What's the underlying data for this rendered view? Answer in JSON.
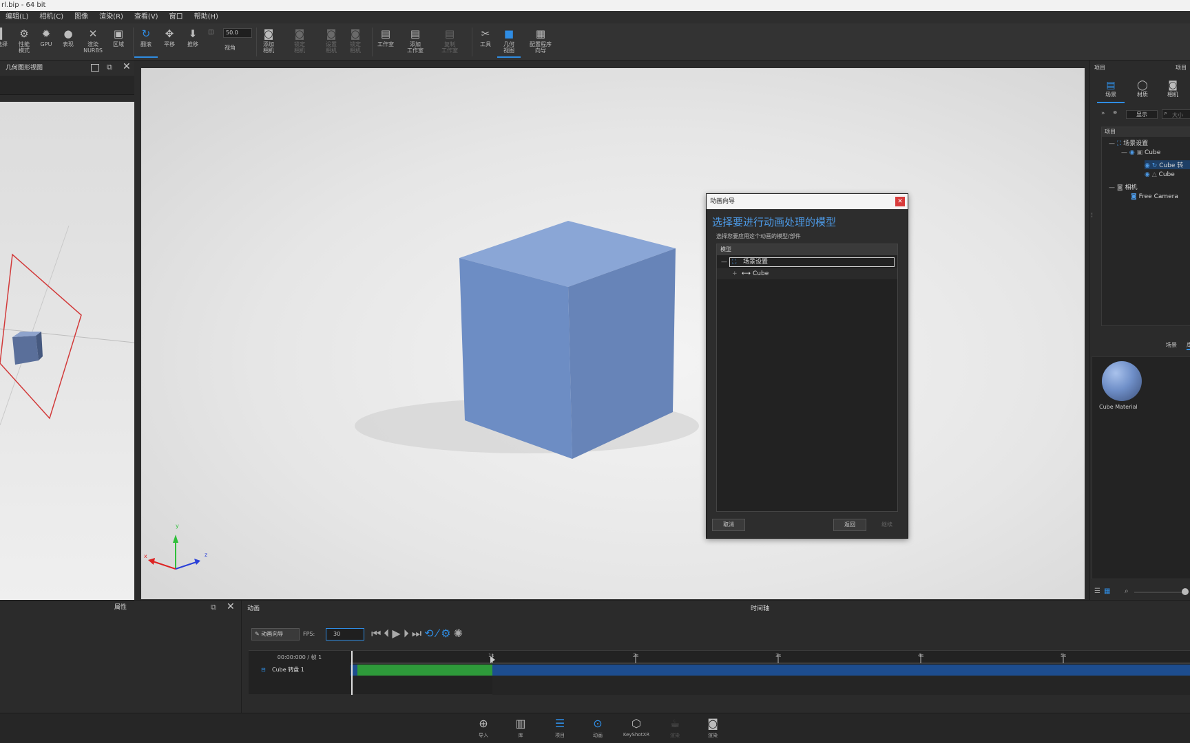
{
  "window": {
    "title": "rl.bip - 64 bit"
  },
  "menu": [
    "编辑(L)",
    "相机(C)",
    "图像",
    "渲染(R)",
    "查看(V)",
    "窗口",
    "帮助(H)"
  ],
  "toolbar": {
    "items": [
      {
        "label": "选择",
        "icon": "cursor-icon"
      },
      {
        "label": "性能\n模式",
        "icon": "gauge-icon"
      },
      {
        "label": "GPU",
        "icon": "gpu-icon"
      },
      {
        "label": "表现",
        "icon": "sphere-icon"
      },
      {
        "label": "渲染\nNURBS",
        "icon": "nurbs-icon"
      },
      {
        "label": "区域",
        "icon": "region-icon"
      },
      {
        "label": "翻滚",
        "icon": "rotate-icon"
      },
      {
        "label": "平移",
        "icon": "pan-icon"
      },
      {
        "label": "推移",
        "icon": "dolly-icon"
      },
      {
        "label": "视角",
        "icon": "fov-icon"
      },
      {
        "label": "添加\n相机",
        "icon": "add-camera-icon"
      },
      {
        "label": "锁定\n相机",
        "icon": "lock-camera-icon"
      },
      {
        "label": "设置\n相机",
        "icon": "set-camera-icon"
      },
      {
        "label": "锁定\n相机",
        "icon": "camera2-icon"
      },
      {
        "label": "工作室",
        "icon": "studio-icon"
      },
      {
        "label": "添加\n工作室",
        "icon": "add-studio-icon"
      },
      {
        "label": "复制\n工作室",
        "icon": "copy-studio-icon"
      },
      {
        "label": "工具",
        "icon": "tools-icon"
      },
      {
        "label": "几何\n视图",
        "icon": "geometry-view-icon"
      },
      {
        "label": "配置程序\n向导",
        "icon": "configurator-icon"
      }
    ],
    "fov_value": "50.0"
  },
  "left_panel": {
    "title": "几何图形视图"
  },
  "dialog": {
    "title": "动画向导",
    "heading": "选择要进行动画处理的模型",
    "subtitle": "选择您要应用这个动画的模型/部件",
    "tree_header": "模型",
    "tree": [
      {
        "label": "场景设置",
        "selected": true
      },
      {
        "label": "Cube",
        "selected": false
      }
    ],
    "cancel": "取消",
    "back": "返回",
    "next": "继续"
  },
  "right_panel": {
    "title": "项目",
    "tabs": [
      "场景",
      "材质",
      "相机"
    ],
    "display_btn": "显示",
    "search_placeholder": "大小",
    "tree_header": "项目",
    "tree": [
      {
        "label": "场景设置",
        "indent": 0
      },
      {
        "label": "Cube",
        "indent": 1
      },
      {
        "label": "Cube 转",
        "indent": 2
      },
      {
        "label": "Cube",
        "indent": 2
      },
      {
        "label": "相机",
        "indent": 0
      },
      {
        "label": "Free Camera",
        "indent": 1
      }
    ],
    "mat_tabs": [
      "场景",
      "库"
    ],
    "material": "Cube Material"
  },
  "bottom": {
    "attributes_title": "属性",
    "animation_title": "动画",
    "timeline_title": "时间轴",
    "wizard_btn": "动画向导",
    "fps_label": "FPS:",
    "fps_value": "30",
    "time_readout": "00:00:000 / 帧 1",
    "track_name": "Cube 转盘 1",
    "ticks": [
      "1s",
      "2s",
      "3s",
      "4s",
      "5s"
    ]
  },
  "dock": [
    {
      "label": "导入",
      "icon": "import-icon"
    },
    {
      "label": "库",
      "icon": "library-icon"
    },
    {
      "label": "项目",
      "icon": "project-icon"
    },
    {
      "label": "动画",
      "icon": "animation-icon"
    },
    {
      "label": "KeyShotXR",
      "icon": "keyshotxr-icon"
    },
    {
      "label": "渲染",
      "icon": "render-icon"
    },
    {
      "label": "渲染",
      "icon": "screenshot-icon"
    }
  ],
  "colors": {
    "accent": "#2f8de4",
    "cube": "#7394c8",
    "clip_green": "#2e9a3a",
    "clip_blue": "#1d4d8f"
  }
}
